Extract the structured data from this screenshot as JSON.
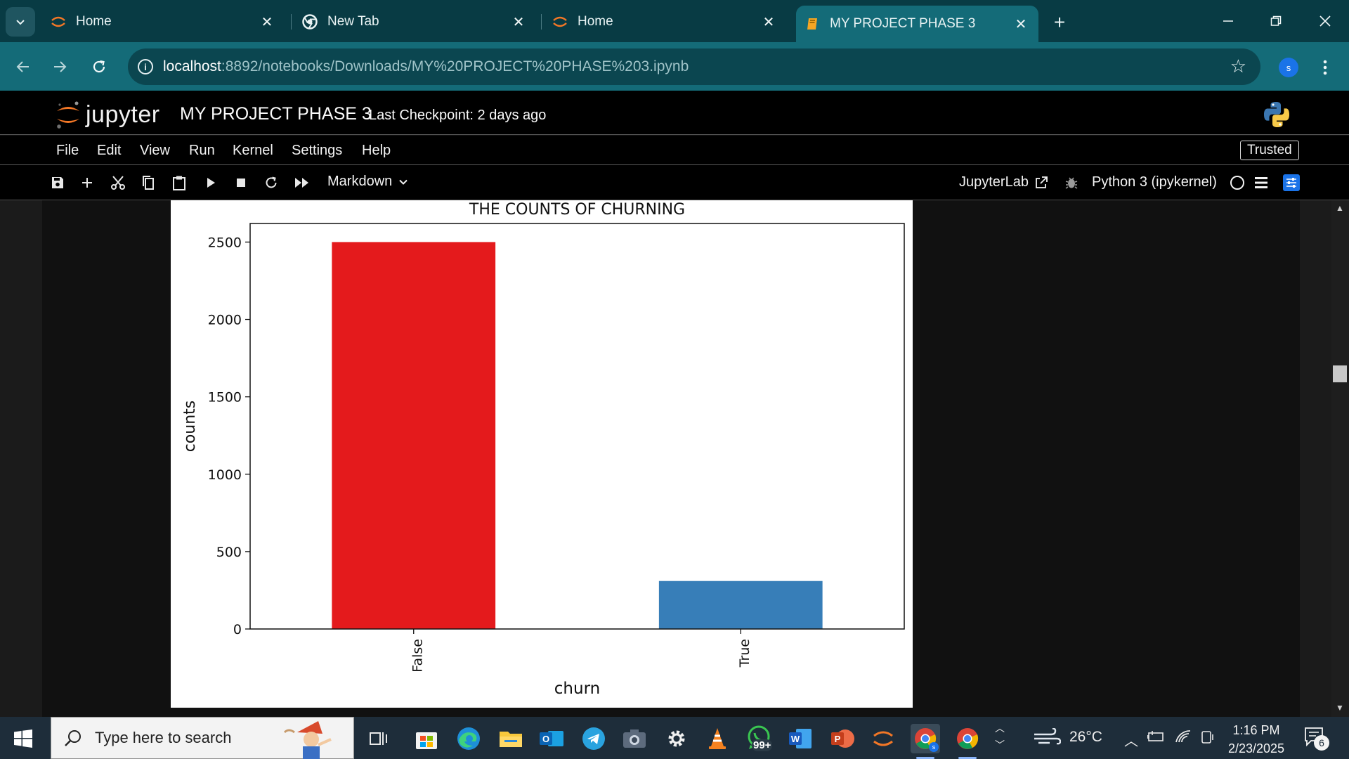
{
  "browser": {
    "tabs": [
      {
        "title": "Home",
        "icon": "jupyter-icon",
        "active": false
      },
      {
        "title": "New Tab",
        "icon": "chrome-icon",
        "active": false
      },
      {
        "title": "Home",
        "icon": "jupyter-icon",
        "active": false
      },
      {
        "title": "MY PROJECT PHASE 3",
        "icon": "notebook-icon",
        "active": true
      }
    ],
    "url_host": "localhost",
    "url_path": ":8892/notebooks/Downloads/MY%20PROJECT%20PHASE%203.ipynb",
    "profile_initial": "s"
  },
  "jupyter": {
    "logo_text": "jupyter",
    "notebook_title": "MY PROJECT PHASE 3",
    "checkpoint": "Last Checkpoint: 2 days ago",
    "menu": [
      "File",
      "Edit",
      "View",
      "Run",
      "Kernel",
      "Settings",
      "Help"
    ],
    "trusted": "Trusted",
    "cell_type": "Markdown",
    "jupyterlab_link": "JupyterLab",
    "kernel": "Python 3 (ipykernel)"
  },
  "chart_data": {
    "type": "bar",
    "title": "THE COUNTS OF CHURNING",
    "xlabel": "churn",
    "ylabel": "counts",
    "categories": [
      "False",
      "True"
    ],
    "values": [
      2500,
      310
    ],
    "colors": [
      "#e41a1c",
      "#377eb8"
    ],
    "ylim": [
      0,
      2620
    ],
    "yticks": [
      0,
      500,
      1000,
      1500,
      2000,
      2500
    ],
    "grid": false
  },
  "taskbar": {
    "search_placeholder": "Type here to search",
    "whatsapp_badge": "99+",
    "temperature": "26°C",
    "time": "1:16 PM",
    "date": "2/23/2025",
    "notification_count": "6"
  }
}
